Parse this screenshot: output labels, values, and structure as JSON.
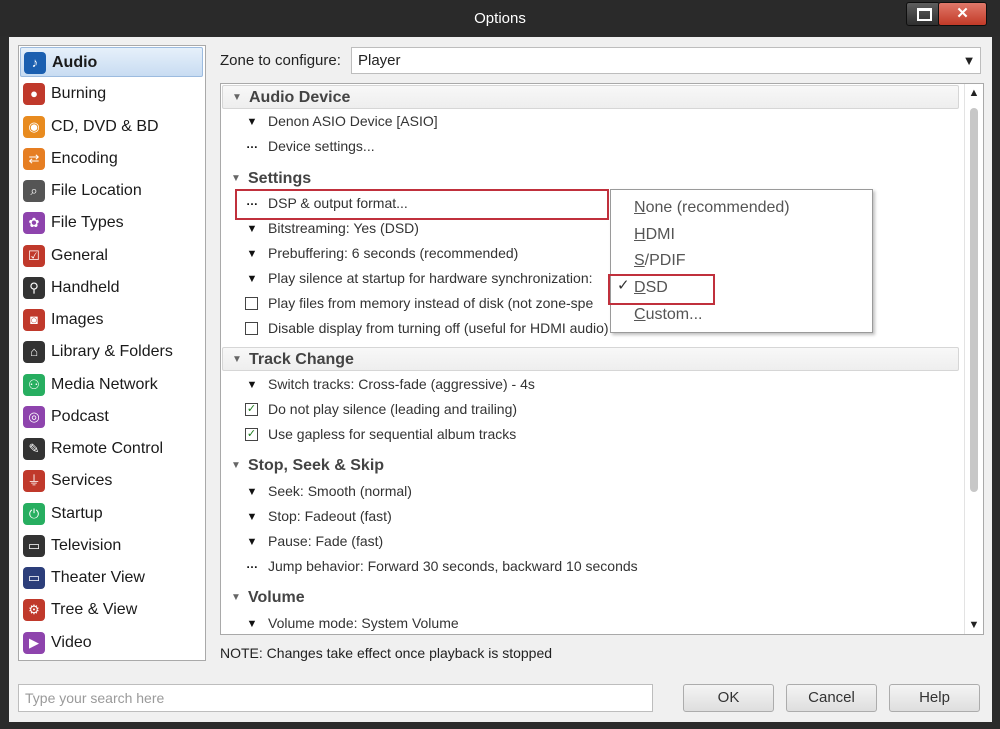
{
  "window": {
    "title": "Options"
  },
  "sidebar": {
    "items": [
      {
        "label": "Audio",
        "icon": "music-note-icon",
        "color": "#1b5fb0",
        "glyph": "♪",
        "selected": true
      },
      {
        "label": "Burning",
        "icon": "burn-disc-icon",
        "color": "#c0392b",
        "glyph": "●"
      },
      {
        "label": "CD, DVD & BD",
        "icon": "disc-icon",
        "color": "#e88b1f",
        "glyph": "◉"
      },
      {
        "label": "Encoding",
        "icon": "encoding-arrows-icon",
        "color": "#e67e22",
        "glyph": "⇄"
      },
      {
        "label": "File Location",
        "icon": "file-search-icon",
        "color": "#555555",
        "glyph": "⌕"
      },
      {
        "label": "File Types",
        "icon": "file-types-icon",
        "color": "#8e44ad",
        "glyph": "✿"
      },
      {
        "label": "General",
        "icon": "checkbox-icon",
        "color": "#c0392b",
        "glyph": "☑"
      },
      {
        "label": "Handheld",
        "icon": "usb-icon",
        "color": "#333333",
        "glyph": "⚲"
      },
      {
        "label": "Images",
        "icon": "camera-icon",
        "color": "#c0392b",
        "glyph": "◙"
      },
      {
        "label": "Library & Folders",
        "icon": "house-icon",
        "color": "#333333",
        "glyph": "⌂"
      },
      {
        "label": "Media Network",
        "icon": "network-icon",
        "color": "#27ae60",
        "glyph": "⚇"
      },
      {
        "label": "Podcast",
        "icon": "podcast-icon",
        "color": "#8e44ad",
        "glyph": "◎"
      },
      {
        "label": "Remote Control",
        "icon": "remote-control-icon",
        "color": "#333333",
        "glyph": "✎"
      },
      {
        "label": "Services",
        "icon": "plug-icon",
        "color": "#c0392b",
        "glyph": "⏚"
      },
      {
        "label": "Startup",
        "icon": "power-icon",
        "color": "#27ae60",
        "glyph": "⏻"
      },
      {
        "label": "Television",
        "icon": "television-icon",
        "color": "#333333",
        "glyph": "▭"
      },
      {
        "label": "Theater View",
        "icon": "monitor-icon",
        "color": "#2c3e7a",
        "glyph": "▭"
      },
      {
        "label": "Tree & View",
        "icon": "gear-icon",
        "color": "#c0392b",
        "glyph": "⚙"
      },
      {
        "label": "Video",
        "icon": "film-camera-icon",
        "color": "#8e44ad",
        "glyph": "▶"
      }
    ]
  },
  "zone": {
    "label": "Zone to configure:",
    "value": "Player"
  },
  "sections": {
    "audio_device": {
      "title": "Audio Device",
      "items": [
        "Denon ASIO Device [ASIO]",
        "Device settings..."
      ]
    },
    "settings": {
      "title": "Settings",
      "items": [
        "DSP & output format...",
        "Bitstreaming: Yes (DSD)",
        "Prebuffering: 6 seconds (recommended)",
        "Play silence at startup for hardware synchronization:",
        "Play files from memory instead of disk (not zone-spe",
        "Disable display from turning off (useful for HDMI audio)"
      ]
    },
    "track_change": {
      "title": "Track Change",
      "items": [
        "Switch tracks: Cross-fade (aggressive) - 4s",
        "Do not play silence (leading and trailing)",
        "Use gapless for sequential album tracks"
      ]
    },
    "stop_seek_skip": {
      "title": "Stop, Seek & Skip",
      "items": [
        "Seek: Smooth (normal)",
        "Stop: Fadeout (fast)",
        "Pause: Fade (fast)",
        "Jump behavior: Forward 30 seconds, backward 10 seconds"
      ]
    },
    "volume": {
      "title": "Volume",
      "items": [
        "Volume mode: System Volume"
      ]
    }
  },
  "bitstream_menu": {
    "items": [
      {
        "first": "N",
        "rest": "one (recommended)"
      },
      {
        "first": "H",
        "rest": "DMI"
      },
      {
        "first": "S",
        "rest": "/PDIF"
      },
      {
        "first": "D",
        "rest": "SD"
      },
      {
        "first": "C",
        "rest": "ustom..."
      }
    ],
    "checked": "DSD",
    "check_glyph": "✓"
  },
  "note": "NOTE: Changes take effect once playback is stopped",
  "search": {
    "placeholder": "Type your search here"
  },
  "buttons": {
    "ok": "OK",
    "cancel": "Cancel",
    "help": "Help"
  },
  "colors": {
    "highlight": "#c0303c",
    "selection": "#c8dcf2"
  }
}
